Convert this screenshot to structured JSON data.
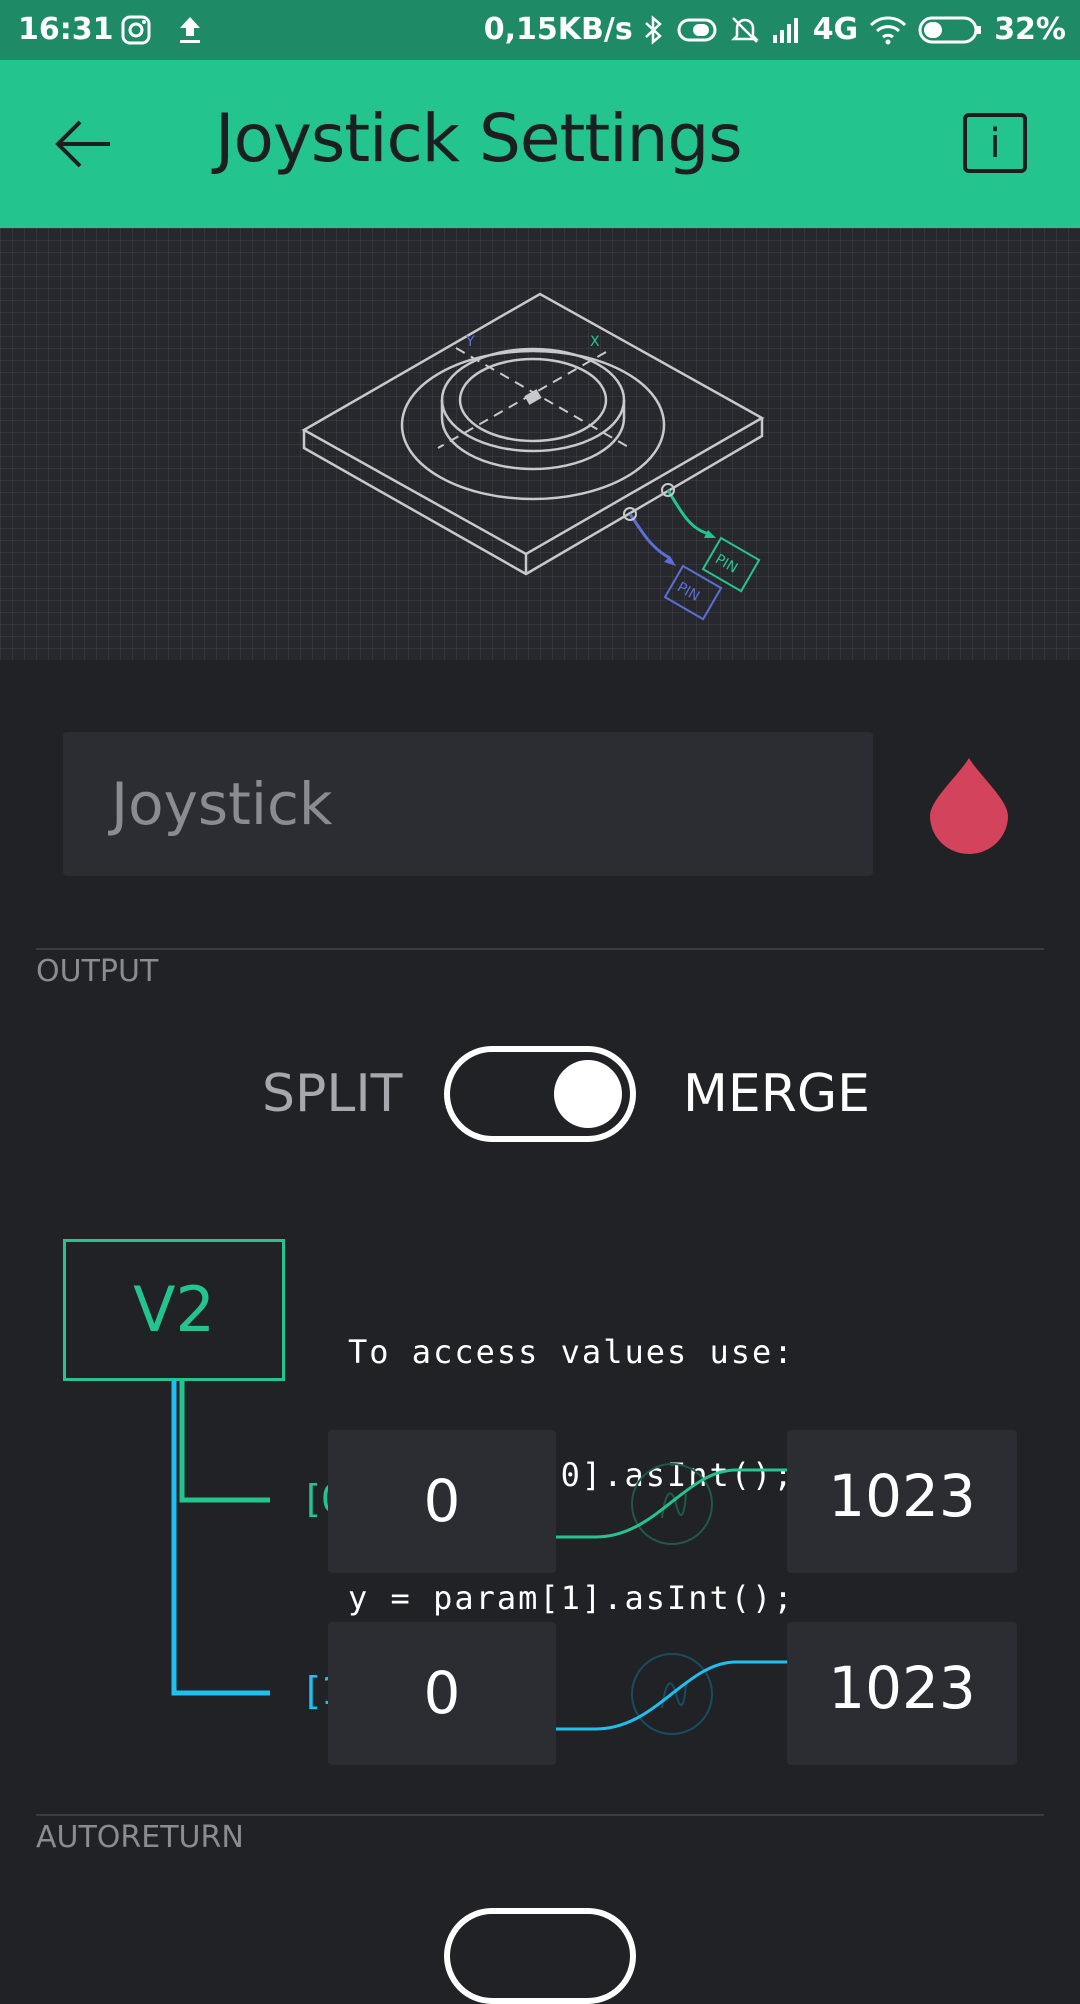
{
  "status_bar": {
    "time": "16:31",
    "network_speed": "0,15KB/s",
    "network_type": "4G",
    "battery": "32%",
    "icons": [
      "instagram-icon",
      "upload-icon",
      "bluetooth-icon",
      "vibrate-icon",
      "mute-icon",
      "signal-icon",
      "wifi-icon",
      "battery-icon"
    ]
  },
  "header": {
    "title": "Joystick Settings",
    "info_label": "i",
    "back_icon": "arrow-left-icon",
    "background": "#23c48e"
  },
  "illustration": {
    "x_axis_label": "X",
    "y_axis_label": "Y",
    "pin_labels": [
      "PIN",
      "PIN"
    ]
  },
  "widget": {
    "name_placeholder": "Joystick",
    "color": "#d3435c"
  },
  "output": {
    "section_label": "OUTPUT",
    "split_label": "SPLIT",
    "merge_label": "MERGE",
    "merge_enabled": true,
    "pin": "V2",
    "code_lines": [
      "To access values use:",
      "x = param[0].asInt();",
      "y = param[1].asInt();"
    ],
    "params": [
      {
        "index_label": "[0]",
        "min": "0",
        "max": "1023",
        "color": "#23c48e"
      },
      {
        "index_label": "[1]",
        "min": "0",
        "max": "1023",
        "color": "#1ec0f0"
      }
    ]
  },
  "autoreturn": {
    "section_label": "AUTORETURN"
  }
}
